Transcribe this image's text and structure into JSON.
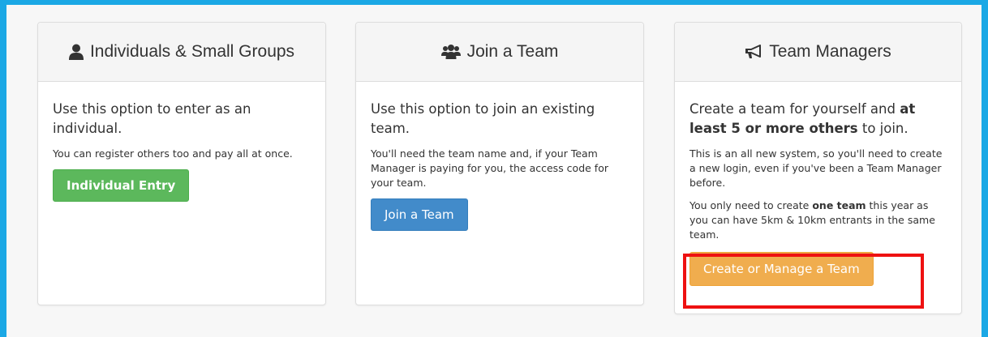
{
  "colors": {
    "frame": "#1ba8e5",
    "green": "#5cb85c",
    "blue": "#428bca",
    "orange": "#f0ad4e",
    "highlight": "#ee1111"
  },
  "panels": {
    "individuals": {
      "icon": "user-icon",
      "title": "Individuals & Small Groups",
      "lead": "Use this option to enter as an individual.",
      "note": "You can register others too and pay all at once.",
      "button": "Individual Entry"
    },
    "join": {
      "icon": "users-icon",
      "title": "Join a Team",
      "lead": "Use this option to join an existing team.",
      "note": "You'll need the team name and, if your Team Manager is paying for you, the access code for your team.",
      "button": "Join a Team"
    },
    "managers": {
      "icon": "bullhorn-icon",
      "title": "Team Managers",
      "lead_pre": "Create a team for yourself and ",
      "lead_bold": "at least 5 or more others",
      "lead_post": " to join.",
      "note1": "This is an all new system, so you'll need to create a new login, even if you've been a Team Manager before.",
      "note2_pre": "You only need to create ",
      "note2_bold": "one team",
      "note2_post": " this year as you can have 5km & 10km entrants in the same team.",
      "button": "Create or Manage a Team"
    }
  }
}
